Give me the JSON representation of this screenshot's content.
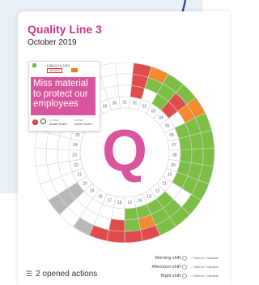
{
  "title": "Quality Line 3",
  "subtitle": "October 2019",
  "center_letter": "Q",
  "colors": {
    "brand": "#cc3388",
    "green": "#7cbf44",
    "red": "#e04b4b",
    "orange": "#f28a2e",
    "gray": "#b8b8b8",
    "white": "#ffffff"
  },
  "action_card": {
    "id": "L3M-Q-10-2421",
    "date": "08/2019",
    "text": "Miss material to protect our employees",
    "count": "1",
    "creator_label": "AUTEUR",
    "creator_name": "Andrew Hooker",
    "owner_label": "OWNER",
    "owner_name": "Andrew Hooker"
  },
  "actions_summary": "2 opened actions",
  "legend": [
    {
      "label": "Morning shift",
      "rule": "⟋ Rules for 2 indicators"
    },
    {
      "label": "Afternoon shift",
      "rule": "⟋ Rules for 2 indicators"
    },
    {
      "label": "Night shift",
      "rule": "⟋ Rules for 2 indicators"
    }
  ],
  "wheel": {
    "days": [
      "31",
      "01",
      "02",
      "03",
      "04",
      "05",
      "06",
      "07",
      "08",
      "09",
      "10",
      "11",
      "12",
      "13",
      "14",
      "15",
      "16",
      "17",
      "18",
      "19",
      "20",
      "21",
      "22",
      "23",
      "24",
      "25",
      "26",
      "27",
      "28",
      "29",
      "30"
    ],
    "status": [
      [
        "w",
        "w",
        "w"
      ],
      [
        "r",
        "r",
        "r"
      ],
      [
        "o",
        "g",
        "w"
      ],
      [
        "g",
        "g",
        "g"
      ],
      [
        "g",
        "r",
        "r"
      ],
      [
        "o",
        "o",
        "w"
      ],
      [
        "g",
        "g",
        "g"
      ],
      [
        "g",
        "g",
        "g"
      ],
      [
        "g",
        "g",
        "g"
      ],
      [
        "g",
        "g",
        "g"
      ],
      [
        "g",
        "g",
        "g"
      ],
      [
        "g",
        "w",
        "w"
      ],
      [
        "g",
        "g",
        "g"
      ],
      [
        "g",
        "g",
        "g"
      ],
      [
        "r",
        "o",
        "g"
      ],
      [
        "r",
        "g",
        "g"
      ],
      [
        "r",
        "r",
        "w"
      ],
      [
        "r",
        "w",
        "w"
      ],
      [
        "y",
        "w",
        "w"
      ],
      [
        "w",
        "w",
        "w"
      ],
      [
        "y",
        "y",
        "y"
      ],
      [
        "w",
        "w",
        "w"
      ],
      [
        "w",
        "w",
        "w"
      ],
      [
        "w",
        "w",
        "w"
      ],
      [
        "w",
        "w",
        "w"
      ],
      [
        "w",
        "w",
        "w"
      ],
      [
        "w",
        "w",
        "w"
      ],
      [
        "w",
        "w",
        "w"
      ],
      [
        "w",
        "w",
        "w"
      ],
      [
        "w",
        "w",
        "w"
      ],
      [
        "w",
        "w",
        "w"
      ]
    ]
  }
}
